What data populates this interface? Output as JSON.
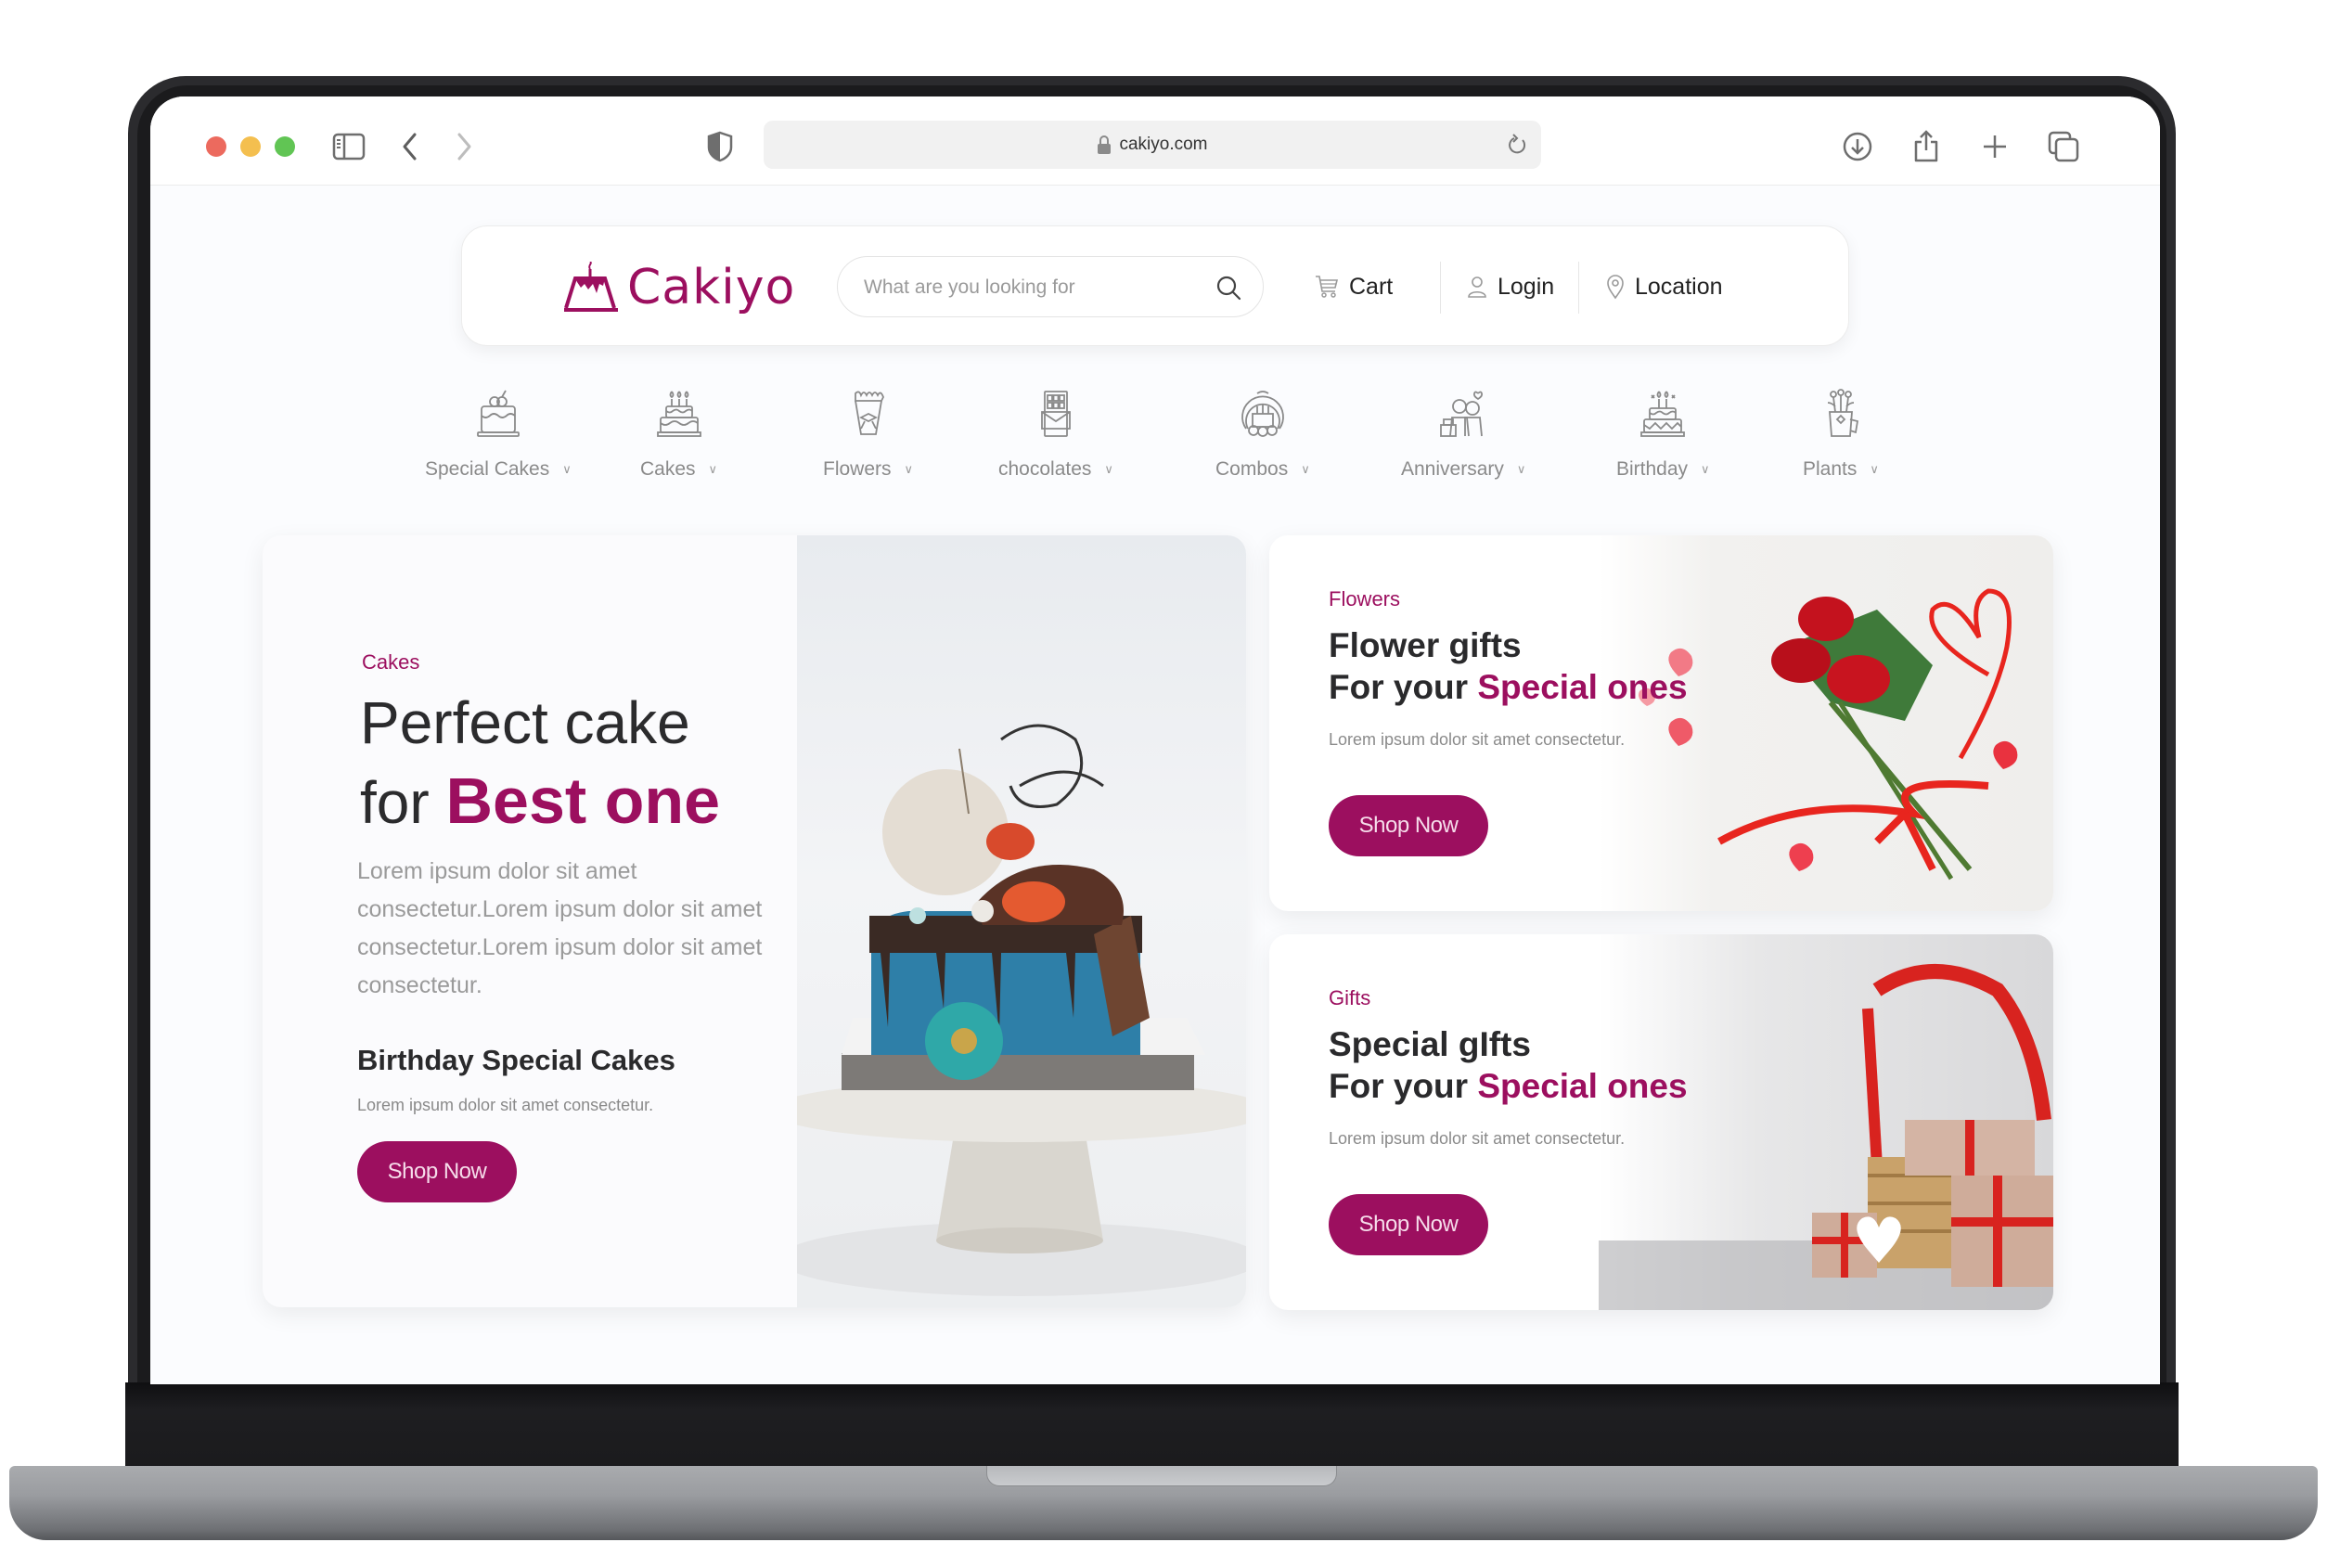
{
  "browser": {
    "url": "cakiyo.com",
    "icons": {
      "sidebar": "sidebar-icon",
      "back": "chevron-left-icon",
      "forward": "chevron-right-icon",
      "privacy": "shield-icon",
      "lock": "lock-icon",
      "reload": "reload-icon",
      "download": "download-icon",
      "share": "share-icon",
      "new_tab": "plus-icon",
      "tabs": "tabs-overview-icon"
    }
  },
  "header": {
    "brand": "Cakiyo",
    "search_placeholder": "What are you looking for",
    "nav": [
      {
        "label": "Cart",
        "icon": "cart-icon"
      },
      {
        "label": "Login",
        "icon": "user-icon"
      },
      {
        "label": "Location",
        "icon": "location-pin-icon"
      }
    ]
  },
  "categories": [
    {
      "label": "Special Cakes",
      "icon": "special-cake-icon"
    },
    {
      "label": "Cakes",
      "icon": "cake-icon"
    },
    {
      "label": "Flowers",
      "icon": "bouquet-icon"
    },
    {
      "label": "chocolates",
      "icon": "chocolate-bar-icon"
    },
    {
      "label": "Combos",
      "icon": "combo-wreath-icon"
    },
    {
      "label": "Anniversary",
      "icon": "couple-icon"
    },
    {
      "label": "Birthday",
      "icon": "birthday-cake-icon"
    },
    {
      "label": "Plants",
      "icon": "plant-icon"
    }
  ],
  "hero": {
    "eyebrow": "Cakes",
    "title_line1": "Perfect cake",
    "title_line2_prefix": "for",
    "title_line2_accent": "Best one",
    "description": "Lorem ipsum dolor sit amet consectetur.Lorem ipsum dolor sit amet consectetur.Lorem ipsum dolor sit amet consectetur.",
    "subtitle": "Birthday Special Cakes",
    "sub_description": "Lorem ipsum dolor sit amet consectetur.",
    "button": "Shop Now",
    "image": "birthday-cake-photo"
  },
  "promos": [
    {
      "eyebrow": "Flowers",
      "title_line1": "Flower gifts",
      "title_line2_prefix": "For your",
      "title_line2_accent": "Special ones",
      "description": "Lorem ipsum dolor sit amet consectetur.",
      "button": "Shop Now",
      "image": "roses-bouquet-photo"
    },
    {
      "eyebrow": "Gifts",
      "title_line1": "Special gIfts",
      "title_line2_prefix": "For your",
      "title_line2_accent": "Special ones",
      "description": "Lorem ipsum dolor sit amet consectetur.",
      "button": "Shop Now",
      "image": "gift-basket-photo"
    }
  ],
  "colors": {
    "brand": "#9c0f5f",
    "text_dark": "#2a2a2c",
    "text_muted": "#8a8a8a"
  }
}
